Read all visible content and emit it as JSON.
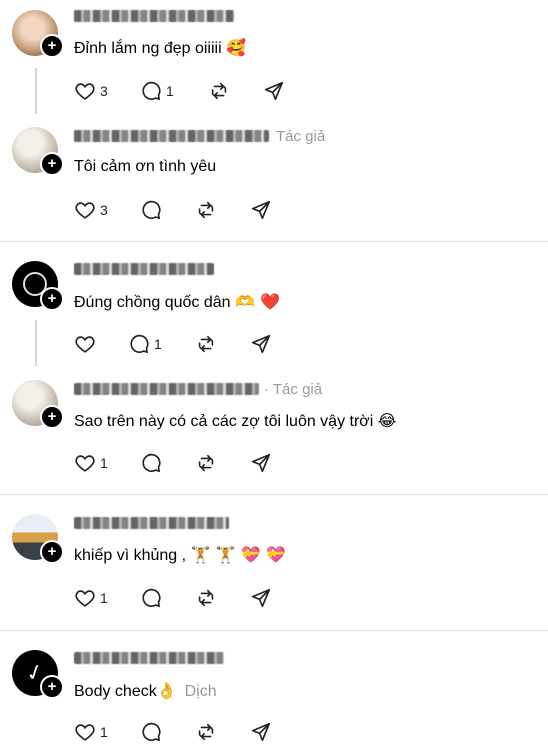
{
  "comments": [
    {
      "text": "Đỉnh lắm ng đẹp oiiiii",
      "emoji": "🥰",
      "likes": "3",
      "replies": "1",
      "author_tag": ""
    },
    {
      "text": "Tôi cảm ơn tình yêu",
      "emoji": "",
      "likes": "3",
      "replies": "",
      "author_tag": "Tác giả"
    },
    {
      "text": "Đúng chồng quốc dân",
      "emoji": "🫶 ❤️",
      "likes": "",
      "replies": "1",
      "author_tag": ""
    },
    {
      "text": "Sao trên này có cả các zợ tôi luôn vậy trời",
      "emoji": "😂",
      "likes": "1",
      "replies": "",
      "author_tag": "· Tác giả"
    },
    {
      "text": "khiếp vì khủng ,",
      "emoji": "🏋 🏋 💝 💝",
      "likes": "1",
      "replies": "",
      "author_tag": ""
    },
    {
      "text": "Body check",
      "emoji": "👌",
      "likes": "1",
      "replies": "",
      "author_tag": "",
      "translate": "Dịch"
    }
  ],
  "icons": {
    "like": "heart-icon",
    "reply": "comment-icon",
    "repost": "repost-icon",
    "share": "send-icon",
    "follow": "plus-icon"
  }
}
